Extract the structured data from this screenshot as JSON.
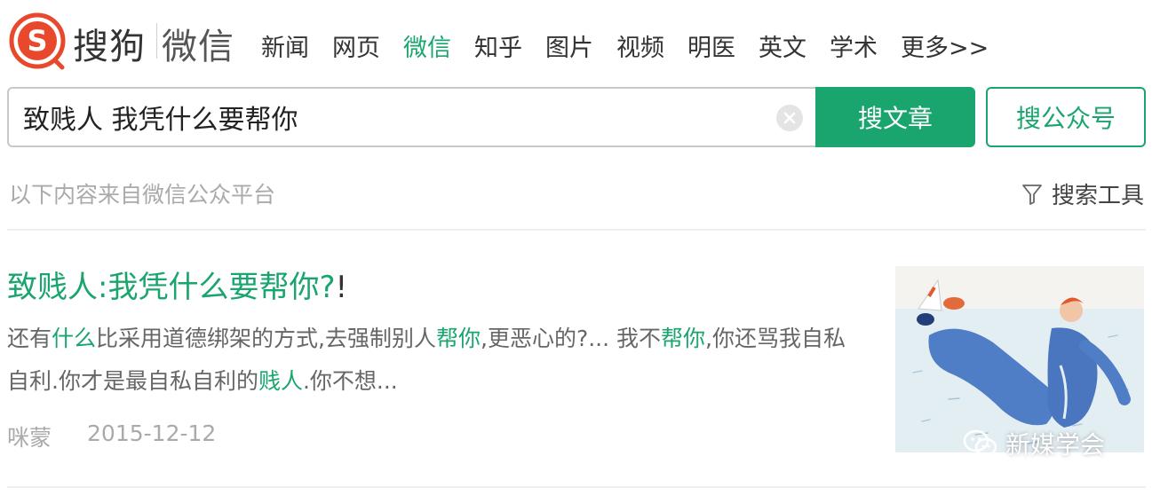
{
  "header": {
    "brand": "搜狗",
    "section": "微信",
    "nav": [
      {
        "label": "新闻",
        "active": false
      },
      {
        "label": "网页",
        "active": false
      },
      {
        "label": "微信",
        "active": true
      },
      {
        "label": "知乎",
        "active": false
      },
      {
        "label": "图片",
        "active": false
      },
      {
        "label": "视频",
        "active": false
      },
      {
        "label": "明医",
        "active": false
      },
      {
        "label": "英文",
        "active": false
      },
      {
        "label": "学术",
        "active": false
      },
      {
        "label": "更多>>",
        "active": false
      }
    ]
  },
  "search": {
    "query": "致贱人 我凭什么要帮你",
    "search_articles_label": "搜文章",
    "search_accounts_label": "搜公众号"
  },
  "info": {
    "source_note": "以下内容来自微信公众平台",
    "search_tools_label": "搜索工具"
  },
  "result": {
    "title_highlight": "致贱人:我凭什么要帮你?",
    "title_tail": "!",
    "snippet_parts": [
      {
        "text": "还有",
        "hl": false
      },
      {
        "text": "什么",
        "hl": true
      },
      {
        "text": "比采用道德绑架的方式,去强制别人",
        "hl": false
      },
      {
        "text": "帮你",
        "hl": true
      },
      {
        "text": ",更恶心的?... 我不",
        "hl": false
      },
      {
        "text": "帮你",
        "hl": true
      },
      {
        "text": ",你还骂我自私自利.你才是最自私自利的",
        "hl": false
      },
      {
        "text": "贱人",
        "hl": true
      },
      {
        "text": ".你不想...",
        "hl": false
      }
    ],
    "author": "咪蒙",
    "date": "2015-12-12",
    "watermark": "新媒学会"
  },
  "colors": {
    "accent": "#1ba56e",
    "logo": "#e8492c"
  }
}
